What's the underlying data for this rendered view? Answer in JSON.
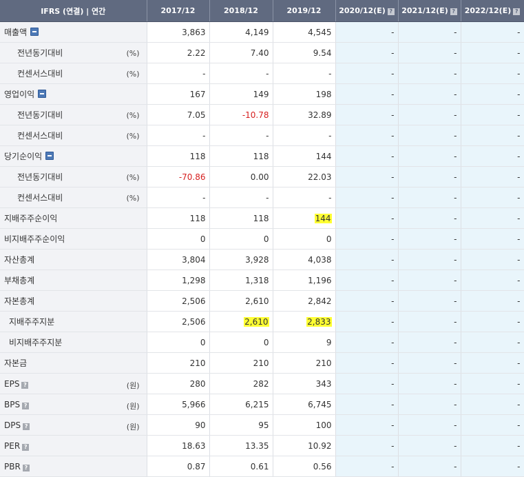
{
  "header": {
    "corner": "IFRS (연결) | 연간",
    "columns": [
      "2017/12",
      "2018/12",
      "2019/12",
      "2020/12(E)",
      "2021/12(E)",
      "2022/12(E)"
    ],
    "help_icon_glyph": "?"
  },
  "colors": {
    "header_bg": "#606a80",
    "label_bg": "#f2f3f6",
    "estimate_bg": "#e9f5fb",
    "negative": "#d61f1f",
    "highlight": "#ffff33"
  },
  "rows": [
    {
      "label": "매출액",
      "unit": "",
      "values": [
        "3,863",
        "4,149",
        "4,545",
        "-",
        "-",
        "-"
      ]
    },
    {
      "label": "전년동기대비",
      "unit": "(%)",
      "values": [
        "2.22",
        "7.40",
        "9.54",
        "-",
        "-",
        "-"
      ]
    },
    {
      "label": "컨센서스대비",
      "unit": "(%)",
      "values": [
        "-",
        "-",
        "-",
        "-",
        "-",
        "-"
      ]
    },
    {
      "label": "영업이익",
      "unit": "",
      "values": [
        "167",
        "149",
        "198",
        "-",
        "-",
        "-"
      ]
    },
    {
      "label": "전년동기대비",
      "unit": "(%)",
      "values": [
        "7.05",
        "-10.78",
        "32.89",
        "-",
        "-",
        "-"
      ]
    },
    {
      "label": "컨센서스대비",
      "unit": "(%)",
      "values": [
        "-",
        "-",
        "-",
        "-",
        "-",
        "-"
      ]
    },
    {
      "label": "당기순이익",
      "unit": "",
      "values": [
        "118",
        "118",
        "144",
        "-",
        "-",
        "-"
      ]
    },
    {
      "label": "전년동기대비",
      "unit": "(%)",
      "values": [
        "-70.86",
        "0.00",
        "22.03",
        "-",
        "-",
        "-"
      ]
    },
    {
      "label": "컨센서스대비",
      "unit": "(%)",
      "values": [
        "-",
        "-",
        "-",
        "-",
        "-",
        "-"
      ]
    },
    {
      "label": "지배주주순이익",
      "unit": "",
      "values": [
        "118",
        "118",
        "144",
        "-",
        "-",
        "-"
      ]
    },
    {
      "label": "비지배주주순이익",
      "unit": "",
      "values": [
        "0",
        "0",
        "0",
        "-",
        "-",
        "-"
      ]
    },
    {
      "label": "자산총계",
      "unit": "",
      "values": [
        "3,804",
        "3,928",
        "4,038",
        "-",
        "-",
        "-"
      ]
    },
    {
      "label": "부채총계",
      "unit": "",
      "values": [
        "1,298",
        "1,318",
        "1,196",
        "-",
        "-",
        "-"
      ]
    },
    {
      "label": "자본총계",
      "unit": "",
      "values": [
        "2,506",
        "2,610",
        "2,842",
        "-",
        "-",
        "-"
      ]
    },
    {
      "label": "지배주주지분",
      "unit": "",
      "values": [
        "2,506",
        "2,610",
        "2,833",
        "-",
        "-",
        "-"
      ]
    },
    {
      "label": "비지배주주지분",
      "unit": "",
      "values": [
        "0",
        "0",
        "9",
        "-",
        "-",
        "-"
      ]
    },
    {
      "label": "자본금",
      "unit": "",
      "values": [
        "210",
        "210",
        "210",
        "-",
        "-",
        "-"
      ]
    },
    {
      "label": "EPS",
      "unit": "(원)",
      "values": [
        "280",
        "282",
        "343",
        "-",
        "-",
        "-"
      ]
    },
    {
      "label": "BPS",
      "unit": "(원)",
      "values": [
        "5,966",
        "6,215",
        "6,745",
        "-",
        "-",
        "-"
      ]
    },
    {
      "label": "DPS",
      "unit": "(원)",
      "values": [
        "90",
        "95",
        "100",
        "-",
        "-",
        "-"
      ]
    },
    {
      "label": "PER",
      "unit": "",
      "values": [
        "18.63",
        "13.35",
        "10.92",
        "-",
        "-",
        "-"
      ]
    },
    {
      "label": "PBR",
      "unit": "",
      "values": [
        "0.87",
        "0.61",
        "0.56",
        "-",
        "-",
        "-"
      ]
    }
  ]
}
